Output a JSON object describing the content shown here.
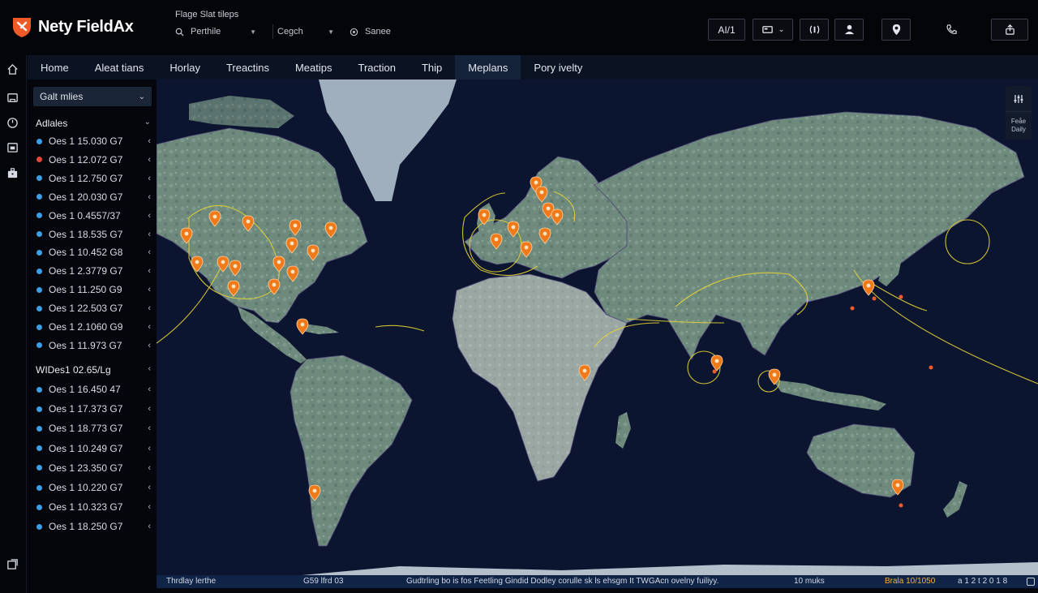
{
  "app": {
    "name": "Nety FieldAx",
    "subtitle": "Flage Slat tileps"
  },
  "header": {
    "filter1": {
      "label": "Perthile"
    },
    "filter2": {
      "label": "Cegch"
    },
    "filter3": {
      "label": "Sanee"
    },
    "buttons": [
      {
        "label": "AI/1",
        "icon": "ai-badge-icon"
      },
      {
        "label": "",
        "icon": "device-dropdown-icon"
      },
      {
        "label": "",
        "icon": "signal-icon"
      },
      {
        "label": "",
        "icon": "user-icon"
      },
      {
        "label": "",
        "icon": "map-pin-icon"
      },
      {
        "label": "",
        "icon": "phone-icon"
      },
      {
        "label": "",
        "icon": "share-icon"
      }
    ]
  },
  "rail": {
    "icons": [
      "home-icon",
      "inbox-icon",
      "clock-icon",
      "calendar-icon",
      "briefcase-icon",
      "export-icon"
    ]
  },
  "nav": {
    "tabs": [
      "Home",
      "Aleat tians",
      "Horlay",
      "Treactins",
      "Meatips",
      "Traction",
      "Thip",
      "Meplans",
      "Pory ivelty"
    ],
    "active_index": 7
  },
  "panel": {
    "select_label": "Galt mlies",
    "group1": {
      "title": "Adlales",
      "items": [
        {
          "label": "Oes 1 15.030 G7",
          "status": "blue"
        },
        {
          "label": "Oes 1 12.072 G7",
          "status": "red"
        },
        {
          "label": "Oes 1 12.750 G7",
          "status": "blue"
        },
        {
          "label": "Oes 1 20.030 G7",
          "status": "blue"
        },
        {
          "label": "Oes 1 0.4557/37",
          "status": "blue"
        },
        {
          "label": "Oes 1 18.535 G7",
          "status": "blue"
        },
        {
          "label": "Oes 1 10.452 G8",
          "status": "blue"
        },
        {
          "label": "Oes 1 2.3779 G7",
          "status": "blue"
        },
        {
          "label": "Oes 1 11.250 G9",
          "status": "blue"
        },
        {
          "label": "Oes 1 22.503 G7",
          "status": "blue"
        },
        {
          "label": "Oes 1 2.1060 G9",
          "status": "blue"
        },
        {
          "label": "Oes 1 11.973 G7",
          "status": "blue"
        }
      ]
    },
    "group2": {
      "title": "WIDes1 02.65/Lg",
      "items": [
        {
          "label": "Oes 1 16.450 47",
          "status": "blue"
        },
        {
          "label": "Oes 1 17.373 G7",
          "status": "blue"
        },
        {
          "label": "Oes 1 18.773 G7",
          "status": "blue"
        },
        {
          "label": "Oes 1 10.249 G7",
          "status": "blue"
        },
        {
          "label": "Oes 1 23.350 G7",
          "status": "blue"
        },
        {
          "label": "Oes 1 10.220 G7",
          "status": "blue"
        },
        {
          "label": "Oes 1 10.323 G7",
          "status": "blue"
        },
        {
          "label": "Oes 1 18.250 G7",
          "status": "blue"
        }
      ]
    }
  },
  "map_tools": {
    "filter_icon": "sliders-icon",
    "label": "Feåe Daily"
  },
  "status_bar": {
    "left": "Thrdlay lerthe",
    "mid_left": "G59 lfrd 03",
    "center": "Gudtrling bo is fos Feetling Gindid Dodley corulle sk ls ehsgm It TWGAcn ovelny fuiliyy.",
    "right1": "10 muks",
    "right2": "Brala 10/1050",
    "right3": "a 1 2 t 2 0 1 8"
  },
  "colors": {
    "ocean": "#0c1530",
    "land": "#6f8b80",
    "pin": "#f07a1a",
    "route": "#e4d233",
    "brand_logo": "#f05a28",
    "dot_blue": "#3aa0e8",
    "dot_red": "#e8453a"
  }
}
